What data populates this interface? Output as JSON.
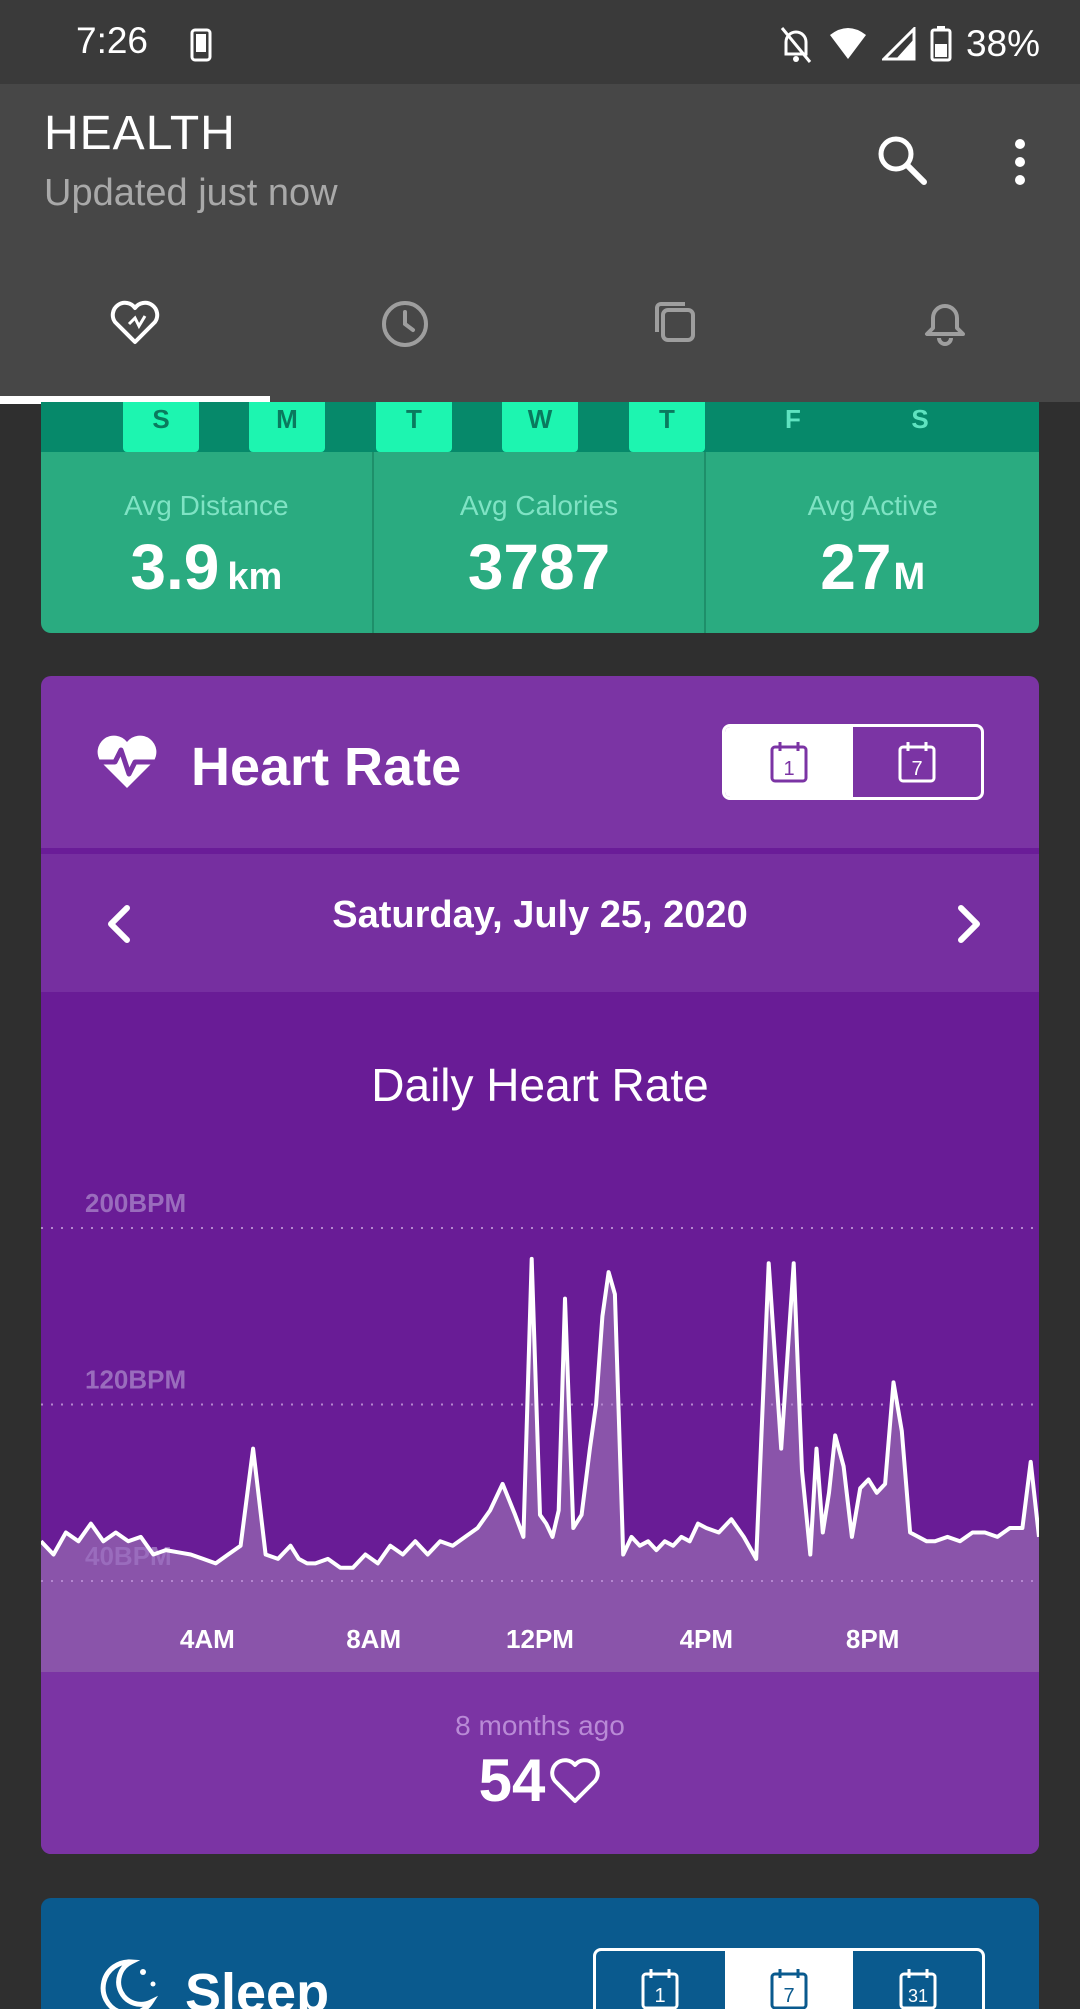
{
  "status_bar": {
    "time": "7:26",
    "battery": "38%"
  },
  "app_bar": {
    "title": "HEALTH",
    "subtitle": "Updated just now"
  },
  "tabs": [
    {
      "name": "health",
      "icon": "heart-icon",
      "active": true
    },
    {
      "name": "history",
      "icon": "clock-icon",
      "active": false
    },
    {
      "name": "overview",
      "icon": "copy-icon",
      "active": false
    },
    {
      "name": "alerts",
      "icon": "bell-icon",
      "active": false
    }
  ],
  "week": {
    "days": [
      {
        "label": "S",
        "active": true
      },
      {
        "label": "M",
        "active": true
      },
      {
        "label": "T",
        "active": true
      },
      {
        "label": "W",
        "active": true
      },
      {
        "label": "T",
        "active": true
      },
      {
        "label": "F",
        "active": false
      },
      {
        "label": "S",
        "active": false
      }
    ],
    "stats": [
      {
        "label": "Avg Distance",
        "value": "3.9",
        "unit": "km"
      },
      {
        "label": "Avg Calories",
        "value": "3787",
        "unit": ""
      },
      {
        "label": "Avg Active",
        "value": "27",
        "unit": "M"
      }
    ]
  },
  "heart_rate": {
    "title": "Heart Rate",
    "range_options": [
      {
        "label": "1",
        "active": true
      },
      {
        "label": "7",
        "active": false
      }
    ],
    "date": "Saturday, July 25, 2020",
    "last_reading_time": "8 months ago",
    "last_reading_value": "54",
    "colors": {
      "card": "#7b34a4",
      "chart_bg": "#691c96",
      "line": "#ffffff"
    }
  },
  "sleep": {
    "title": "Sleep",
    "range_options": [
      {
        "label": "1",
        "active": false
      },
      {
        "label": "7",
        "active": true
      },
      {
        "label": "31",
        "active": false
      }
    ]
  },
  "chart_data": {
    "type": "area",
    "title": "Daily Heart Rate",
    "xlabel": "",
    "ylabel": "",
    "x_ticks": [
      "4AM",
      "8AM",
      "12PM",
      "4PM",
      "8PM"
    ],
    "y_ticks": [
      "40BPM",
      "120BPM",
      "200BPM"
    ],
    "y_tick_values": [
      40,
      120,
      200
    ],
    "ylim": [
      40,
      200
    ],
    "xlim_hours": [
      0,
      24
    ],
    "series": [
      {
        "x": [
          0,
          0.3,
          0.6,
          0.9,
          1.2,
          1.5,
          1.8,
          2.1,
          2.4,
          2.7,
          3.0,
          3.3,
          3.6,
          3.9,
          4.2,
          4.5,
          4.8,
          5.1,
          5.4,
          5.7,
          6.0,
          6.2,
          6.4,
          6.6,
          6.9,
          7.2,
          7.5,
          7.8,
          8.1,
          8.4,
          8.7,
          9.0,
          9.3,
          9.6,
          9.9,
          10.2,
          10.5,
          10.8,
          11.1,
          11.4,
          11.6,
          11.8,
          12.0,
          12.15,
          12.3,
          12.45,
          12.6,
          12.8,
          13.0,
          13.2,
          13.35,
          13.5,
          13.65,
          13.8,
          14.0,
          14.2,
          14.4,
          14.6,
          14.8,
          15.0,
          15.2,
          15.4,
          15.6,
          15.8,
          16.0,
          16.3,
          16.6,
          16.9,
          17.2,
          17.5,
          17.8,
          18.1,
          18.3,
          18.5,
          18.65,
          18.8,
          18.95,
          19.1,
          19.3,
          19.5,
          19.7,
          19.9,
          20.1,
          20.3,
          20.5,
          20.7,
          20.9,
          21.1,
          21.3,
          21.5,
          21.8,
          22.1,
          22.4,
          22.7,
          23.0,
          23.3,
          23.6,
          23.8,
          24.0
        ],
        "values": [
          58,
          52,
          62,
          58,
          66,
          58,
          62,
          58,
          60,
          52,
          54,
          53,
          52,
          50,
          48,
          52,
          56,
          100,
          52,
          50,
          56,
          50,
          48,
          48,
          50,
          46,
          46,
          52,
          48,
          56,
          52,
          58,
          52,
          58,
          56,
          60,
          64,
          72,
          84,
          70,
          60,
          186,
          70,
          66,
          60,
          72,
          168,
          64,
          70,
          100,
          120,
          160,
          180,
          170,
          52,
          60,
          56,
          58,
          54,
          58,
          56,
          60,
          58,
          66,
          64,
          62,
          68,
          60,
          50,
          184,
          100,
          184,
          90,
          52,
          100,
          62,
          80,
          106,
          92,
          60,
          82,
          86,
          80,
          84,
          130,
          108,
          62,
          60,
          58,
          58,
          60,
          58,
          62,
          62,
          60,
          64,
          64,
          94,
          60
        ]
      }
    ]
  }
}
